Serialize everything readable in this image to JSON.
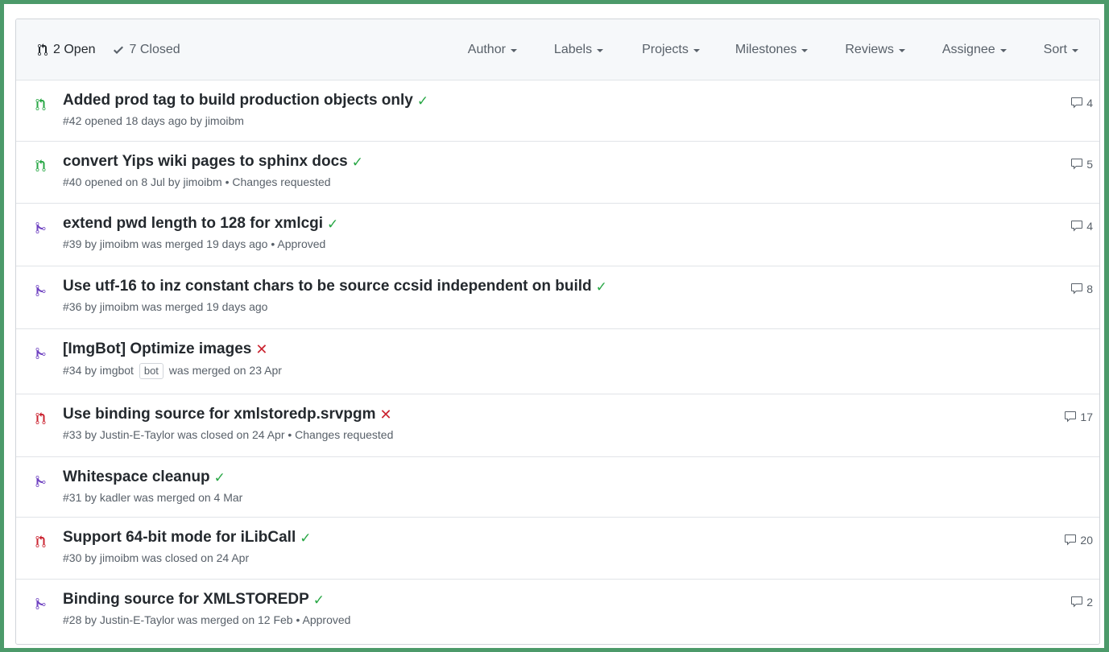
{
  "header": {
    "open_label": "2 Open",
    "closed_label": "7 Closed",
    "filters": [
      "Author",
      "Labels",
      "Projects",
      "Milestones",
      "Reviews",
      "Assignee",
      "Sort"
    ]
  },
  "colors": {
    "open": "#28a745",
    "merged": "#6f42c1",
    "closed": "#cb2431",
    "check": "#28a745",
    "fail": "#cb2431"
  },
  "pull_requests": [
    {
      "state": "open",
      "title": "Added prod tag to build production objects only",
      "status": "success",
      "meta": "#42 opened 18 days ago by jimoibm",
      "comments": "4"
    },
    {
      "state": "open",
      "title": "convert Yips wiki pages to sphinx docs",
      "status": "success",
      "meta": "#40 opened on 8 Jul by jimoibm • Changes requested",
      "comments": "5"
    },
    {
      "state": "merged",
      "title": "extend pwd length to 128 for xmlcgi",
      "status": "success",
      "meta": "#39 by jimoibm was merged 19 days ago • Approved",
      "comments": "4"
    },
    {
      "state": "merged",
      "title": "Use utf-16 to inz constant chars to be source ccsid independent on build",
      "status": "success",
      "meta": "#36 by jimoibm was merged 19 days ago",
      "comments": "8"
    },
    {
      "state": "merged",
      "title": "[ImgBot] Optimize images",
      "status": "failure",
      "meta_prefix": "#34 by imgbot",
      "bot_label": "bot",
      "meta_suffix": "was merged on 23 Apr",
      "comments": ""
    },
    {
      "state": "closed",
      "title": "Use binding source for xmlstoredp.srvpgm",
      "status": "failure",
      "meta": "#33 by Justin-E-Taylor was closed on 24 Apr • Changes requested",
      "comments": "17"
    },
    {
      "state": "merged",
      "title": "Whitespace cleanup",
      "status": "success",
      "meta": "#31 by kadler was merged on 4 Mar",
      "comments": ""
    },
    {
      "state": "closed",
      "title": "Support 64-bit mode for iLibCall",
      "status": "success",
      "meta": "#30 by jimoibm was closed on 24 Apr",
      "comments": "20"
    },
    {
      "state": "merged",
      "title": "Binding source for XMLSTOREDP",
      "status": "success",
      "meta": "#28 by Justin-E-Taylor was merged on 12 Feb • Approved",
      "comments": "2"
    }
  ]
}
